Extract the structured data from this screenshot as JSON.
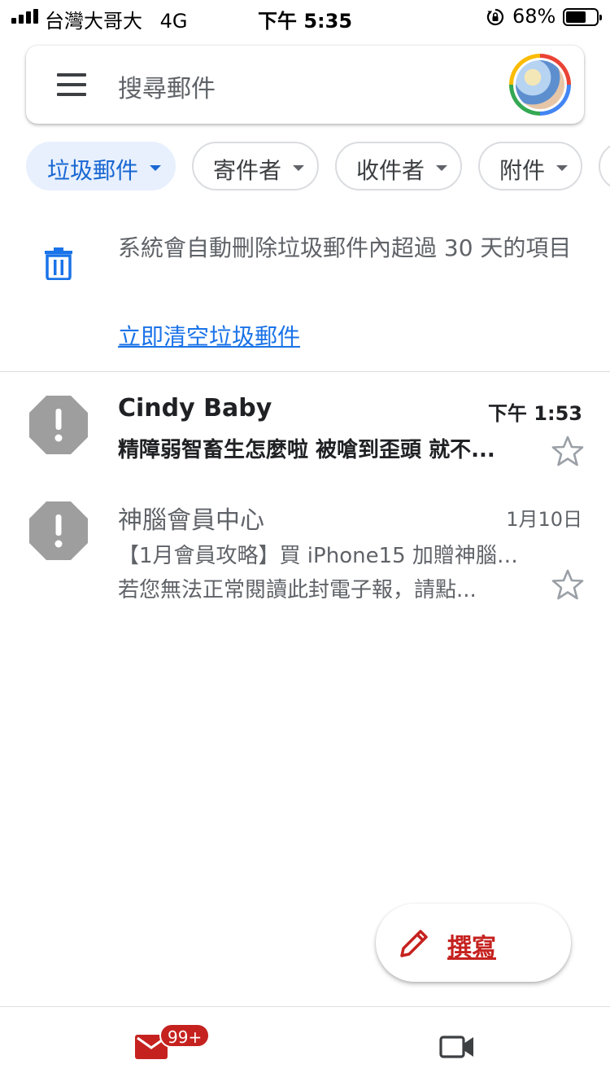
{
  "status_bar": {
    "carrier": "台灣大哥大",
    "network": "4G",
    "time": "下午 5:35",
    "battery_pct": "68%",
    "battery_level": 0.68
  },
  "search": {
    "placeholder": "搜尋郵件"
  },
  "chips": [
    {
      "label": "垃圾郵件",
      "active": true
    },
    {
      "label": "寄件者",
      "active": false
    },
    {
      "label": "收件者",
      "active": false
    },
    {
      "label": "附件",
      "active": false
    }
  ],
  "notice": {
    "text": "系統會自動刪除垃圾郵件內超過 30 天的項目",
    "link": "立即清空垃圾郵件"
  },
  "mails": [
    {
      "sender": "Cindy Baby",
      "time": "下午 1:53",
      "line1": "精障弱智畜生怎麼啦 被嗆到歪頭 就不...",
      "line2": "",
      "unread": true
    },
    {
      "sender": "神腦會員中心",
      "time": "1月10日",
      "line1": "【1月會員攻略】買 iPhone15 加贈神腦幣...",
      "line2": "若您無法正常閱讀此封電子報，請點...",
      "unread": false
    }
  ],
  "compose": {
    "label": "撰寫"
  },
  "bottom_nav": {
    "mail_badge": "99+"
  },
  "colors": {
    "accent_blue": "#1a73e8",
    "compose_red": "#c5221f",
    "chip_active_bg": "#e8f0fe"
  },
  "icons": [
    "menu-icon",
    "trash-icon",
    "spam-icon",
    "star-icon",
    "pencil-icon",
    "mail-icon",
    "video-icon"
  ]
}
